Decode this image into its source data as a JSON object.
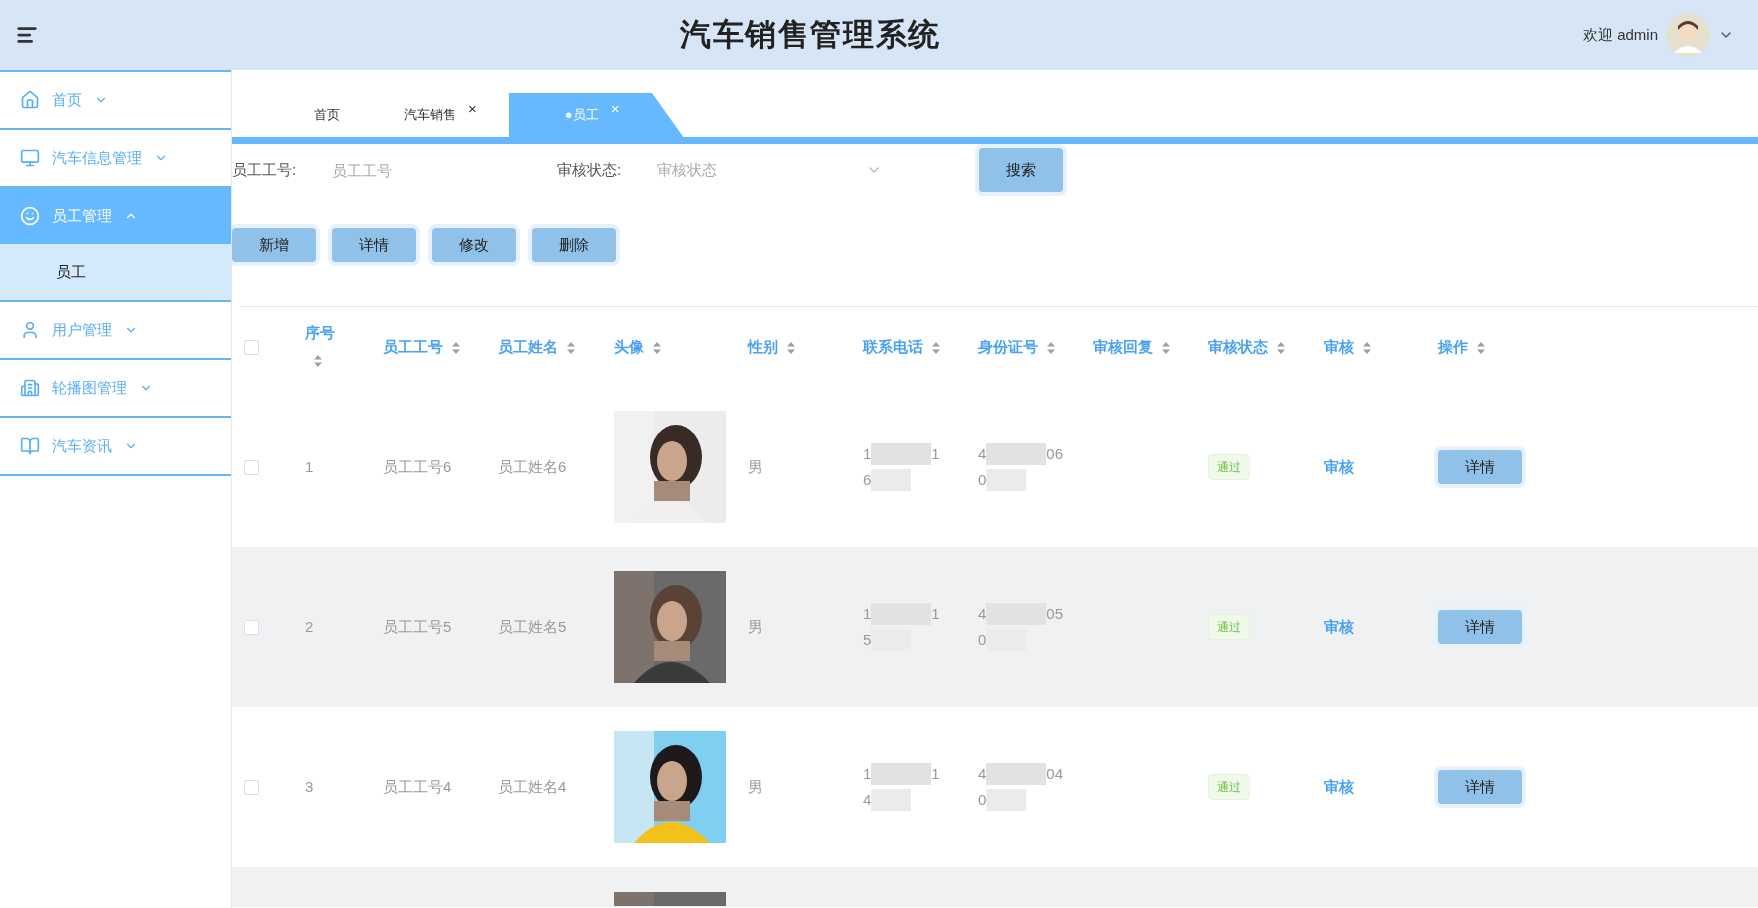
{
  "header": {
    "title": "汽车销售管理系统",
    "welcome": "欢迎 admin"
  },
  "sidebar": {
    "items": [
      {
        "label": "首页",
        "selected": false,
        "expanded": false
      },
      {
        "label": "汽车信息管理",
        "selected": false,
        "expanded": false
      },
      {
        "label": "员工管理",
        "selected": true,
        "expanded": true,
        "children": [
          {
            "label": "员工",
            "selected": true
          }
        ]
      },
      {
        "label": "用户管理",
        "selected": false,
        "expanded": false
      },
      {
        "label": "轮播图管理",
        "selected": false,
        "expanded": false
      },
      {
        "label": "汽车资讯",
        "selected": false,
        "expanded": false
      }
    ]
  },
  "tabs": [
    {
      "label": "首页",
      "closable": false,
      "selected": false
    },
    {
      "label": "汽车销售",
      "closable": true,
      "selected": false
    },
    {
      "label": "●员工",
      "closable": true,
      "selected": true
    }
  ],
  "close_glyph": "×",
  "search": {
    "fields": [
      {
        "kind": "input",
        "label": "员工工号:",
        "placeholder": "员工工号"
      },
      {
        "kind": "select",
        "label": "审核状态:",
        "placeholder": "审核状态"
      }
    ],
    "button": "搜索"
  },
  "actions": [
    "新增",
    "详情",
    "修改",
    "删除"
  ],
  "table": {
    "select_all": {
      "checked": false
    },
    "columns": [
      "序号",
      "员工工号",
      "员工姓名",
      "头像",
      "性别",
      "联系电话",
      "身份证号",
      "审核回复",
      "审核状态",
      "审核",
      "操作"
    ],
    "rows": [
      {
        "checked": false,
        "index": "1",
        "number": "员工工号6",
        "name": "员工姓名6",
        "avatar": {
          "kind": "picture"
        },
        "gender": "男",
        "phone": {
          "start": "1",
          "end": "1",
          "line_2": "6"
        },
        "id_card": {
          "start": "4",
          "end": "06",
          "line_2": "0"
        },
        "status": "通过",
        "review": "审核",
        "action": "详情"
      },
      {
        "checked": false,
        "index": "2",
        "number": "员工工号5",
        "name": "员工姓名5",
        "avatar": {
          "kind": "picture"
        },
        "gender": "男",
        "phone": {
          "start": "1",
          "end": "1",
          "line_2": "5"
        },
        "id_card": {
          "start": "4",
          "end": "05",
          "line_2": "0"
        },
        "status": "通过",
        "review": "审核",
        "action": "详情"
      },
      {
        "checked": false,
        "index": "3",
        "number": "员工工号4",
        "name": "员工姓名4",
        "avatar": {
          "kind": "picture"
        },
        "gender": "男",
        "phone": {
          "start": "1",
          "end": "1",
          "line_2": "4"
        },
        "id_card": {
          "start": "4",
          "end": "04",
          "line_2": "0"
        },
        "status": "通过",
        "review": "审核",
        "action": "详情"
      },
      {
        "avatar": {
          "kind": "picture"
        }
      }
    ]
  }
}
